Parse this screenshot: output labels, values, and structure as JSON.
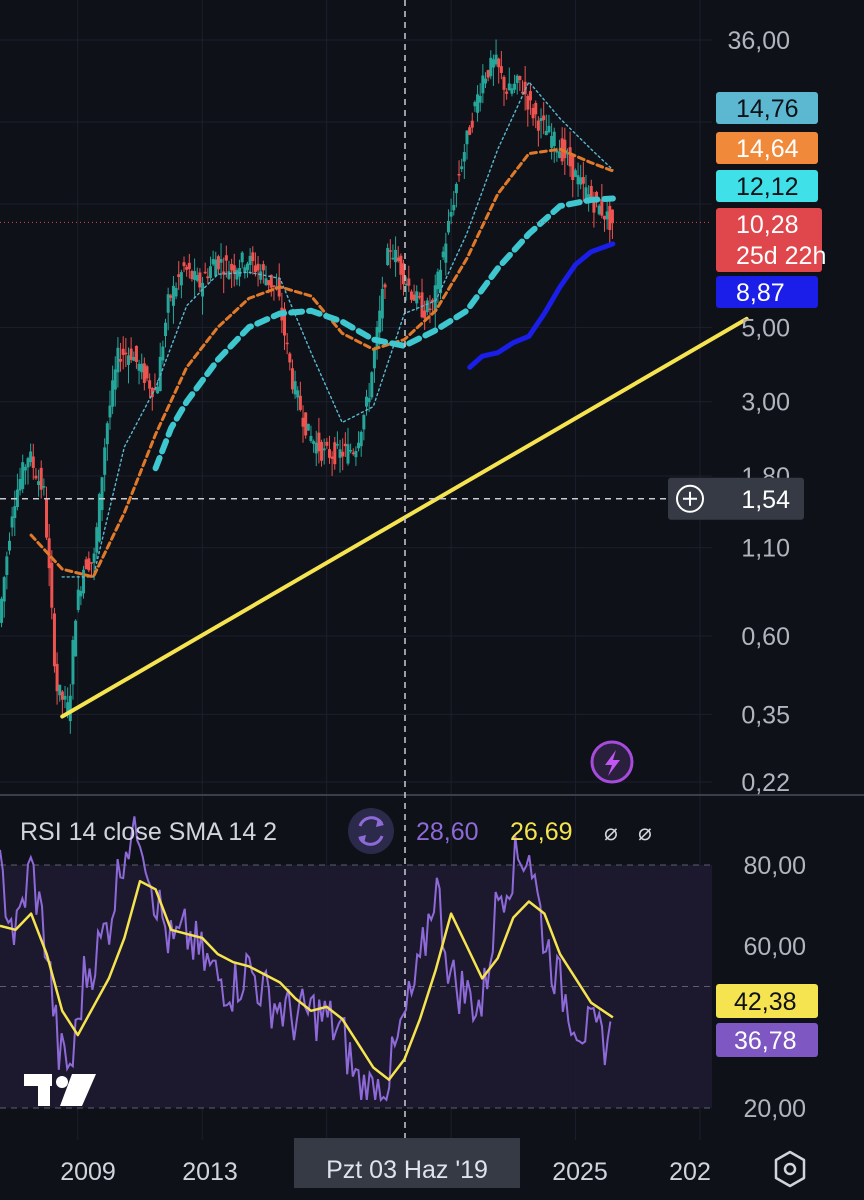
{
  "chart_data": [
    {
      "type": "line",
      "name": "price",
      "scale": "log",
      "ylim": [
        0.22,
        38
      ],
      "yticks": [
        "36,00",
        "5,00",
        "3,00",
        "1,80",
        "1,10",
        "0,60",
        "0,35",
        "0,22"
      ],
      "xticks": [
        "2009",
        "2013",
        "2025",
        "202"
      ],
      "crosshair": {
        "price_label": "1,54",
        "date_label": "Pzt 03 Haz '19"
      },
      "price_tags": [
        {
          "value": "14,76",
          "color": "#5bb8d0",
          "text_color": "#0e1118"
        },
        {
          "value": "14,64",
          "color": "#f08a3a",
          "text_color": "#ffffff"
        },
        {
          "value": "12,12",
          "color": "#3fe0e8",
          "text_color": "#0e1118"
        },
        {
          "value": "10,28",
          "sub": "25d 22h",
          "color": "#e0474c",
          "text_color": "#ffffff"
        },
        {
          "value": "8,87",
          "color": "#1a1ee8",
          "text_color": "#ffffff"
        }
      ],
      "price_series": {
        "x": [
          2006.5,
          2007.0,
          2007.5,
          2008.0,
          2008.4,
          2008.8,
          2009.0,
          2009.3,
          2009.6,
          2010.0,
          2010.4,
          2010.8,
          2011.2,
          2011.6,
          2012.0,
          2012.5,
          2013.0,
          2013.5,
          2014.0,
          2014.5,
          2015.0,
          2015.5,
          2016.0,
          2016.5,
          2017.0,
          2017.5,
          2018.0,
          2018.4,
          2018.8,
          2019.1,
          2019.4,
          2019.8,
          2020.2,
          2020.5,
          2020.9,
          2021.3,
          2021.7,
          2022.1,
          2022.5,
          2022.9,
          2023.3,
          2023.7,
          2024.0,
          2024.4,
          2024.8,
          2025.2,
          2025.6,
          2026.0,
          2026.2
        ],
        "y": [
          0.6,
          1.5,
          2.1,
          1.6,
          0.42,
          0.36,
          0.7,
          1.0,
          1.0,
          2.5,
          4.2,
          4.2,
          3.6,
          3.2,
          6.0,
          7.5,
          6.7,
          8.0,
          7.5,
          8.0,
          7.3,
          6.4,
          3.4,
          2.4,
          2.1,
          2.1,
          2.2,
          3.0,
          5.5,
          8.8,
          7.8,
          6.4,
          5.6,
          5.8,
          9.0,
          14.0,
          20.0,
          28.0,
          31.0,
          25.0,
          27.0,
          22.0,
          20.0,
          18.0,
          16.0,
          13.5,
          12.0,
          11.0,
          10.28
        ]
      },
      "moving_averages": [
        {
          "color": "#5bb8d0",
          "style": "dotted",
          "x": [
            2008.5,
            2009.5,
            2010.5,
            2011.5,
            2012.5,
            2013.5,
            2014.5,
            2015.5,
            2016.5,
            2017.5,
            2018.5,
            2019.5,
            2020.5,
            2021.5,
            2022.5,
            2023.5,
            2024.5,
            2025.5,
            2026.2
          ],
          "y": [
            0.9,
            0.9,
            2.2,
            3.3,
            5.8,
            7.2,
            7.3,
            7.0,
            4.2,
            2.6,
            2.9,
            5.5,
            6.0,
            9.5,
            17,
            27,
            21,
            17,
            14.76
          ]
        },
        {
          "color": "#e07a2a",
          "style": "dashed",
          "x": [
            2007.5,
            2008.5,
            2009.5,
            2010.5,
            2011.5,
            2012.5,
            2013.5,
            2014.5,
            2015.5,
            2016.5,
            2017.5,
            2018.5,
            2019.5,
            2020.5,
            2021.5,
            2022.5,
            2023.5,
            2024.5,
            2025.5,
            2026.2
          ],
          "y": [
            1.2,
            0.95,
            0.9,
            1.4,
            2.4,
            3.8,
            5.0,
            6.1,
            6.6,
            6.2,
            4.8,
            4.3,
            4.6,
            5.6,
            8.0,
            12.5,
            16.5,
            17.0,
            15.5,
            14.64
          ]
        },
        {
          "color": "#3fc7cf",
          "style": "thickdash",
          "x": [
            2011.5,
            2012.0,
            2012.5,
            2013.5,
            2014.5,
            2015.5,
            2016.5,
            2017.5,
            2018.5,
            2019.5,
            2020.5,
            2021.5,
            2022.5,
            2023.5,
            2024.5,
            2025.5,
            2026.2
          ],
          "y": [
            1.9,
            2.5,
            3.0,
            4.0,
            5.0,
            5.5,
            5.6,
            5.2,
            4.6,
            4.4,
            4.9,
            5.6,
            7.5,
            9.5,
            11.5,
            12.0,
            12.12
          ]
        },
        {
          "color": "#1a1ee8",
          "style": "solid",
          "x": [
            2021.6,
            2022.0,
            2022.5,
            2023.0,
            2023.5,
            2024.0,
            2024.5,
            2025.0,
            2025.5,
            2026.2
          ],
          "y": [
            3.8,
            4.1,
            4.2,
            4.5,
            4.7,
            5.5,
            6.6,
            7.7,
            8.4,
            8.87
          ]
        }
      ],
      "trendline": {
        "color": "#f5e34f",
        "x": [
          2008.5,
          2030.5
        ],
        "y": [
          0.345,
          5.3
        ]
      }
    },
    {
      "type": "line",
      "name": "rsi",
      "legend": {
        "label": "RSI 14 close SMA 14 2",
        "rsi_value": "28,60",
        "sma_value": "26,69",
        "flags": [
          "⌀",
          "⌀"
        ]
      },
      "ylim": [
        20,
        85
      ],
      "yticks": [
        "80,00",
        "60,00",
        "20,00"
      ],
      "tags": [
        {
          "value": "42,38",
          "color": "#f5e34f",
          "text_color": "#0e1118"
        },
        {
          "value": "36,78",
          "color": "#7e57c2",
          "text_color": "#ffffff"
        }
      ],
      "rsi_series": {
        "x": [
          2006.5,
          2007.0,
          2007.5,
          2008.0,
          2008.4,
          2008.8,
          2009.2,
          2009.6,
          2010.0,
          2010.5,
          2011.0,
          2011.5,
          2012.0,
          2012.5,
          2013.0,
          2013.5,
          2014.0,
          2014.5,
          2015.0,
          2015.5,
          2016.0,
          2016.5,
          2017.0,
          2017.5,
          2018.0,
          2018.5,
          2019.0,
          2019.5,
          2020.0,
          2020.5,
          2021.0,
          2021.5,
          2022.0,
          2022.5,
          2023.0,
          2023.5,
          2024.0,
          2024.5,
          2025.0,
          2025.5,
          2026.2
        ],
        "y": [
          78,
          62,
          80,
          60,
          33,
          30,
          52,
          58,
          66,
          85,
          90,
          72,
          60,
          63,
          57,
          52,
          50,
          55,
          48,
          45,
          42,
          44,
          42,
          38,
          26,
          24,
          28,
          42,
          54,
          76,
          52,
          48,
          45,
          72,
          80,
          84,
          62,
          50,
          42,
          38,
          36.78
        ]
      },
      "sma_series": {
        "x": [
          2006.5,
          2007.0,
          2007.5,
          2008.0,
          2008.5,
          2009.0,
          2009.5,
          2010.0,
          2010.5,
          2011.0,
          2011.5,
          2012.0,
          2012.5,
          2013.0,
          2013.5,
          2014.0,
          2014.5,
          2015.0,
          2015.5,
          2016.0,
          2016.5,
          2017.0,
          2017.5,
          2018.0,
          2018.5,
          2019.0,
          2019.5,
          2020.0,
          2020.5,
          2021.0,
          2021.5,
          2022.0,
          2022.5,
          2023.0,
          2023.5,
          2024.0,
          2024.5,
          2025.0,
          2025.5,
          2026.2
        ],
        "y": [
          65,
          64,
          68,
          58,
          44,
          38,
          45,
          52,
          62,
          76,
          74,
          64,
          63,
          62,
          58,
          56,
          55,
          53,
          51,
          47,
          44,
          45,
          42,
          36,
          30,
          27,
          32,
          42,
          54,
          68,
          60,
          52,
          57,
          67,
          71,
          68,
          58,
          52,
          46,
          42.38
        ]
      }
    }
  ],
  "ui": {
    "logo_text": "TV",
    "settings_icon": "gear-icon",
    "crosshair_add_icon": "plus-circle-icon",
    "alert_icon": "lightning-icon",
    "legend_icon": "refresh-icon"
  }
}
